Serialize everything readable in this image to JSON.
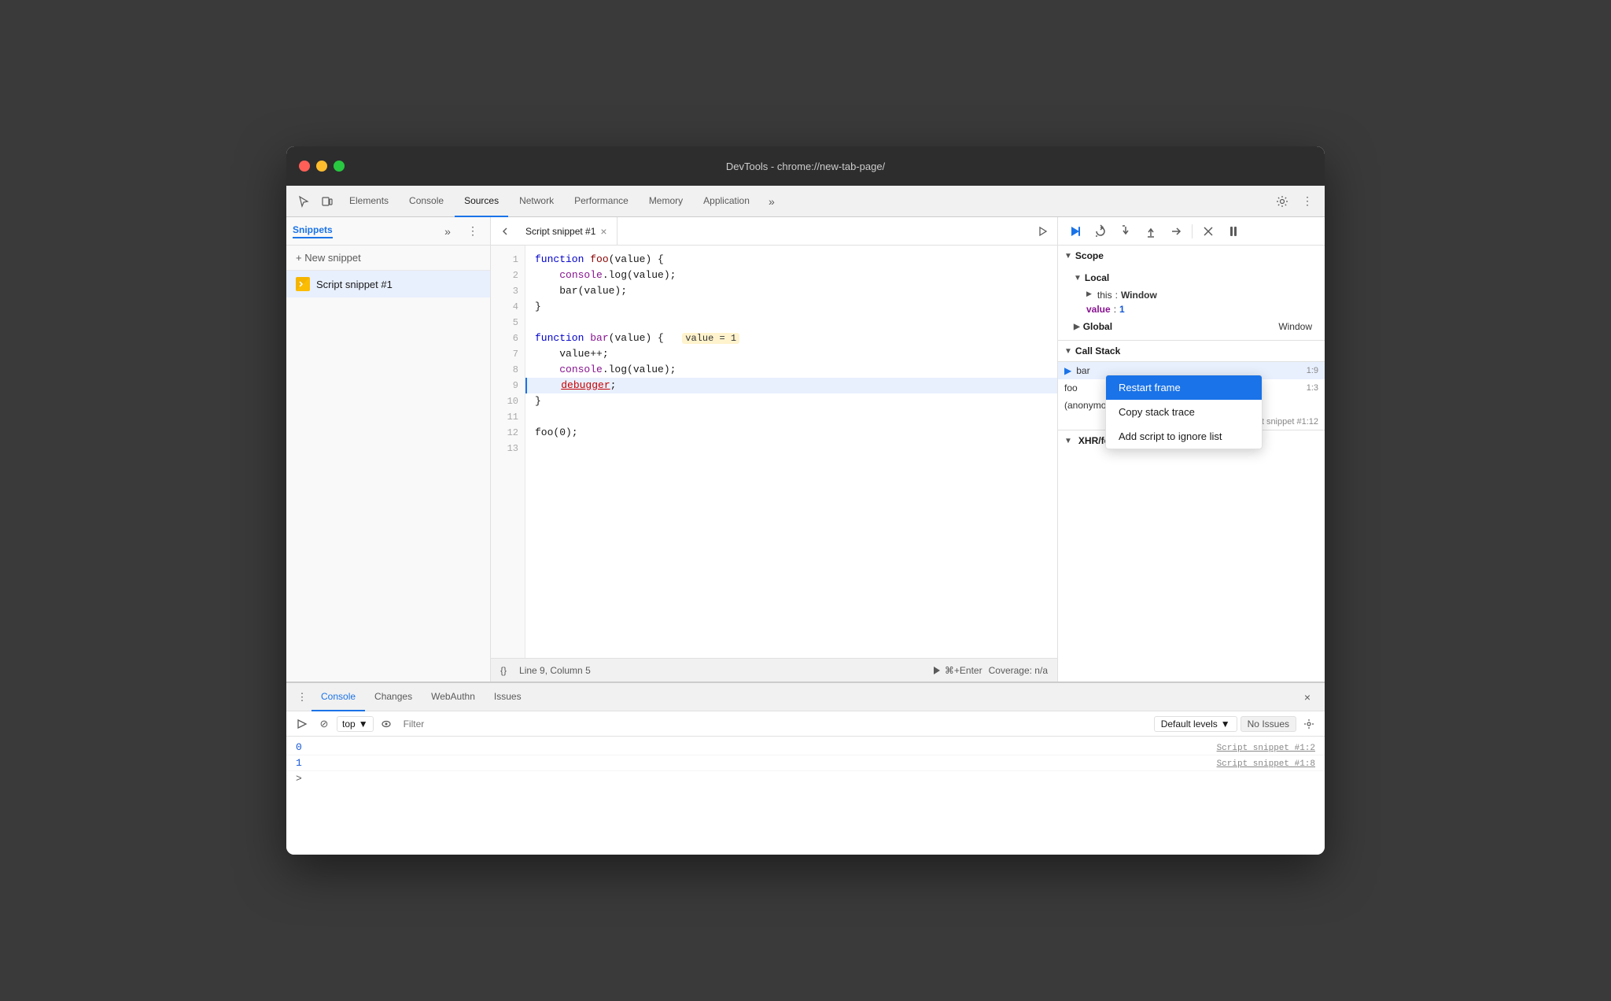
{
  "window": {
    "title": "DevTools - chrome://new-tab-page/"
  },
  "titlebar": {
    "red": "#ff5f57",
    "yellow": "#ffbd2e",
    "green": "#28c840"
  },
  "tabs": {
    "items": [
      {
        "id": "elements",
        "label": "Elements",
        "active": false
      },
      {
        "id": "console",
        "label": "Console",
        "active": false
      },
      {
        "id": "sources",
        "label": "Sources",
        "active": true
      },
      {
        "id": "network",
        "label": "Network",
        "active": false
      },
      {
        "id": "performance",
        "label": "Performance",
        "active": false
      },
      {
        "id": "memory",
        "label": "Memory",
        "active": false
      },
      {
        "id": "application",
        "label": "Application",
        "active": false
      }
    ]
  },
  "left_panel": {
    "title": "Snippets",
    "new_snippet_label": "+ New snippet",
    "snippet_name": "Script snippet #1"
  },
  "editor": {
    "tab_label": "Script snippet #1",
    "code_lines": [
      {
        "num": 1,
        "content": "function foo(value) {",
        "highlight": false,
        "debugger": false
      },
      {
        "num": 2,
        "content": "    console.log(value);",
        "highlight": false,
        "debugger": false
      },
      {
        "num": 3,
        "content": "    bar(value);",
        "highlight": false,
        "debugger": false
      },
      {
        "num": 4,
        "content": "}",
        "highlight": false,
        "debugger": false
      },
      {
        "num": 5,
        "content": "",
        "highlight": false,
        "debugger": false
      },
      {
        "num": 6,
        "content": "function bar(value) {",
        "highlight": false,
        "debugger": false,
        "has_badge": true,
        "badge_text": "value = 1"
      },
      {
        "num": 7,
        "content": "    value++;",
        "highlight": false,
        "debugger": false
      },
      {
        "num": 8,
        "content": "    console.log(value);",
        "highlight": false,
        "debugger": false
      },
      {
        "num": 9,
        "content": "    debugger;",
        "highlight": true,
        "debugger": false
      },
      {
        "num": 10,
        "content": "}",
        "highlight": false,
        "debugger": false
      },
      {
        "num": 11,
        "content": "",
        "highlight": false,
        "debugger": false
      },
      {
        "num": 12,
        "content": "foo(0);",
        "highlight": false,
        "debugger": false
      },
      {
        "num": 13,
        "content": "",
        "highlight": false,
        "debugger": false
      }
    ],
    "status": {
      "format_label": "{}",
      "position": "Line 9, Column 5",
      "run_label": "⌘+Enter",
      "coverage": "Coverage: n/a"
    }
  },
  "debugger_panel": {
    "scope_label": "Scope",
    "local_label": "Local",
    "this_key": "this",
    "this_val": "Window",
    "value_key": "value",
    "value_val": "1",
    "global_label": "Global",
    "global_val": "Window",
    "callstack_label": "Call Stack",
    "call_items": [
      {
        "name": "bar",
        "location": "1:9",
        "active": true
      },
      {
        "name": "foo",
        "location": "1:3",
        "active": false
      },
      {
        "name": "(anonymous)",
        "location": "",
        "active": false
      }
    ],
    "anon_location": "Script snippet #1:12",
    "xhr_label": "XHR/fetch Breakpoints"
  },
  "context_menu": {
    "items": [
      {
        "label": "Restart frame",
        "selected": true
      },
      {
        "label": "Copy stack trace",
        "selected": false
      },
      {
        "label": "Add script to ignore list",
        "selected": false
      }
    ]
  },
  "bottom_panel": {
    "tabs": [
      {
        "id": "console",
        "label": "Console",
        "active": true
      },
      {
        "id": "changes",
        "label": "Changes",
        "active": false
      },
      {
        "id": "webauthn",
        "label": "WebAuthn",
        "active": false
      },
      {
        "id": "issues",
        "label": "Issues",
        "active": false
      }
    ],
    "console_toolbar": {
      "top_label": "top",
      "filter_placeholder": "Filter",
      "levels_label": "Default levels",
      "no_issues_label": "No Issues"
    },
    "output_rows": [
      {
        "value": "0",
        "source": "Script snippet #1:2"
      },
      {
        "value": "1",
        "source": "Script snippet #1:8"
      }
    ],
    "prompt": ">"
  }
}
